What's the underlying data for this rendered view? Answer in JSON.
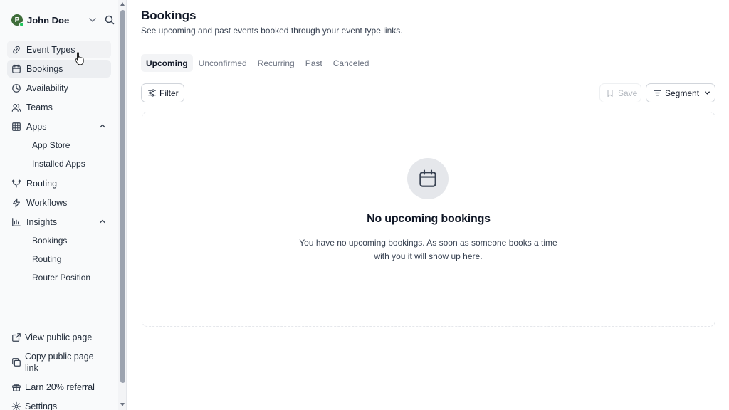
{
  "user": {
    "initial": "P",
    "name": "John Doe"
  },
  "nav": {
    "event_types": "Event Types",
    "bookings": "Bookings",
    "availability": "Availability",
    "teams": "Teams",
    "apps": "Apps",
    "apps_sub": [
      "App Store",
      "Installed Apps"
    ],
    "routing": "Routing",
    "workflows": "Workflows",
    "insights": "Insights",
    "insights_sub": [
      "Bookings",
      "Routing",
      "Router Position"
    ]
  },
  "bottom_nav": {
    "view_public_page": "View public page",
    "copy_public_page_link": "Copy public page link",
    "earn_referral": "Earn 20% referral",
    "settings": "Settings"
  },
  "page": {
    "title": "Bookings",
    "subtitle": "See upcoming and past events booked through your event type links."
  },
  "tabs": [
    "Upcoming",
    "Unconfirmed",
    "Recurring",
    "Past",
    "Canceled"
  ],
  "toolbar": {
    "filter": "Filter",
    "save": "Save",
    "segment": "Segment"
  },
  "empty_state": {
    "title": "No upcoming bookings",
    "text": "You have no upcoming bookings. As soon as someone books a time with you it will show up here."
  },
  "colors": {
    "accent": "#111827",
    "avatar": "#3f6d3a",
    "online": "#22c55e",
    "muted": "#6b7280"
  }
}
